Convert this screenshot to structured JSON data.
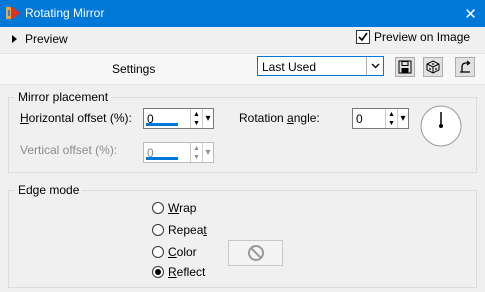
{
  "window": {
    "title": "Rotating Mirror",
    "close_glyph": "✕"
  },
  "header": {
    "preview_label": "Preview",
    "preview_on_image_label": "Preview on Image",
    "preview_on_image_checked": true
  },
  "settings": {
    "label": "Settings",
    "preset_value": "Last Used"
  },
  "mirror_placement": {
    "title": "Mirror placement",
    "horizontal_label_pre": "",
    "horizontal_label_u": "H",
    "horizontal_label_post": "orizontal offset (%):",
    "horizontal_value": "0",
    "vertical_label": "Vertical offset (%):",
    "vertical_value": "0",
    "rotation_label_pre": "Rotation ",
    "rotation_label_u": "a",
    "rotation_label_post": "ngle:",
    "rotation_value": "0"
  },
  "edge_mode": {
    "title": "Edge mode",
    "options": [
      {
        "pre": "",
        "u": "W",
        "post": "rap",
        "selected": false
      },
      {
        "pre": "Repea",
        "u": "t",
        "post": "",
        "selected": false
      },
      {
        "pre": "",
        "u": "C",
        "post": "olor",
        "selected": false
      },
      {
        "pre": "",
        "u": "R",
        "post": "eflect",
        "selected": true
      }
    ]
  },
  "colors": {
    "accent": "#0078d7",
    "titlebar_text": "#ffffff"
  }
}
